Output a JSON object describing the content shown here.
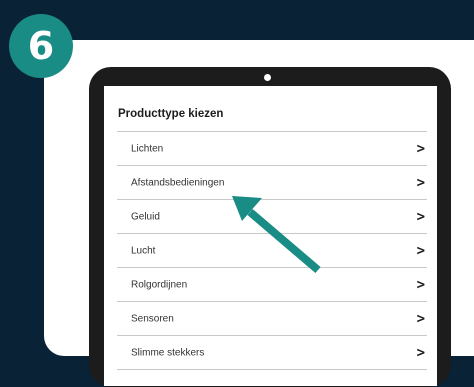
{
  "step": {
    "number": "6",
    "color": "#1a8c86"
  },
  "screen": {
    "title": "Producttype kiezen",
    "items": [
      {
        "label": "Lichten",
        "chevron": ">"
      },
      {
        "label": "Afstandsbedieningen",
        "chevron": ">"
      },
      {
        "label": "Geluid",
        "chevron": ">"
      },
      {
        "label": "Lucht",
        "chevron": ">"
      },
      {
        "label": "Rolgordijnen",
        "chevron": ">"
      },
      {
        "label": "Sensoren",
        "chevron": ">"
      },
      {
        "label": "Slimme stekkers",
        "chevron": ">"
      }
    ]
  },
  "pointer": {
    "icon": "arrow-pointer-icon",
    "target": "Afstandsbedieningen",
    "color": "#1a8c86"
  },
  "colors": {
    "background": "#0a2236",
    "card": "#ffffff",
    "tablet_frame": "#1c1c1c",
    "accent": "#1a8c86"
  }
}
